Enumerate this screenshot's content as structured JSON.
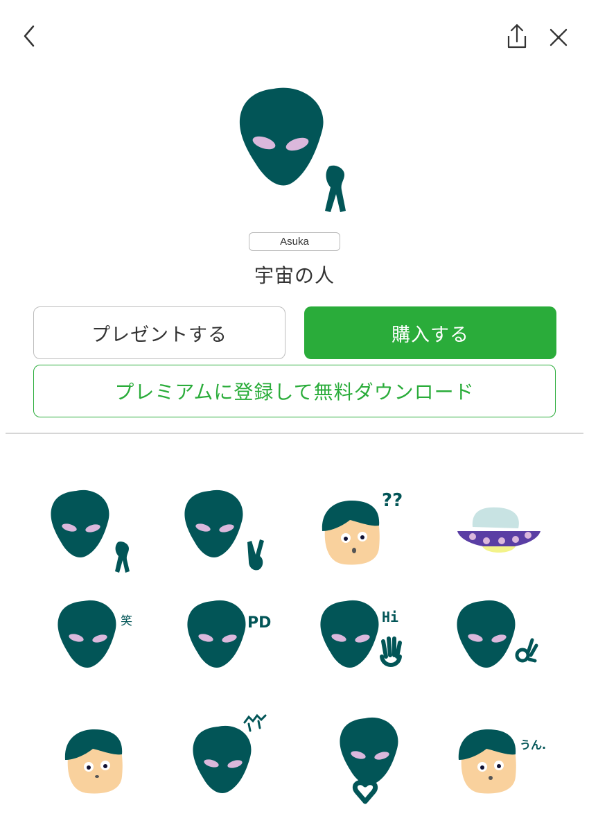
{
  "header": {
    "back_icon": "chevron-left-icon",
    "share_icon": "share-icon",
    "close_icon": "close-icon"
  },
  "product": {
    "author": "Asuka",
    "title": "宇宙の人"
  },
  "actions": {
    "present_label": "プレゼントする",
    "buy_label": "購入する",
    "premium_label": "プレミアムに登録して無料ダウンロード"
  },
  "colors": {
    "brand_green": "#2aac3a",
    "alien": "#025557",
    "eye": "#dbb8dc",
    "skin": "#f9d19d"
  },
  "stickers": {
    "items": [
      {
        "type": "alien",
        "accent": "hand-point",
        "caption": ""
      },
      {
        "type": "alien",
        "accent": "peace-hand",
        "caption": ""
      },
      {
        "type": "boy",
        "accent": "question",
        "caption": "??"
      },
      {
        "type": "ufo",
        "accent": "",
        "caption": ""
      },
      {
        "type": "alien",
        "accent": "text",
        "caption": "笑"
      },
      {
        "type": "alien",
        "accent": "text",
        "caption": "PD"
      },
      {
        "type": "alien",
        "accent": "wave-hand",
        "caption": "Hi"
      },
      {
        "type": "alien",
        "accent": "ok-hand",
        "caption": ""
      },
      {
        "type": "boy",
        "accent": "",
        "caption": ""
      },
      {
        "type": "alien",
        "accent": "text",
        "caption": "^^"
      },
      {
        "type": "alien",
        "accent": "heart-hands",
        "caption": ""
      },
      {
        "type": "boy",
        "accent": "text",
        "caption": "うん."
      }
    ]
  }
}
